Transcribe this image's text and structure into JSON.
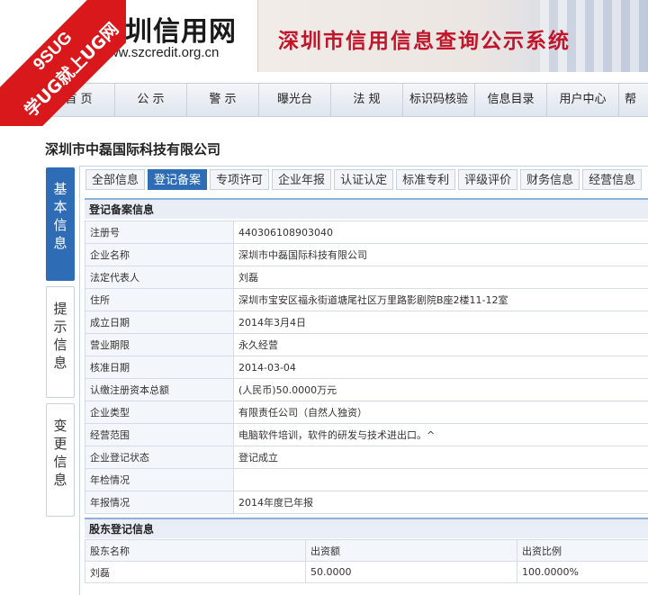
{
  "ribbon": {
    "line1": "9SUG",
    "line2": "学UG就上UG网"
  },
  "header": {
    "logo_text": "深圳信用网",
    "logo_url": "www.szcredit.org.cn",
    "banner_title": "深圳市信用信息查询公示系统"
  },
  "nav": {
    "items": [
      {
        "label": "首  页"
      },
      {
        "label": "公  示"
      },
      {
        "label": "警  示"
      },
      {
        "label": "曝光台"
      },
      {
        "label": "法  规"
      },
      {
        "label": "标识码核验"
      },
      {
        "label": "信息目录"
      },
      {
        "label": "用户中心"
      },
      {
        "label": "帮"
      }
    ]
  },
  "company": {
    "name": "深圳市中磊国际科技有限公司"
  },
  "side_tabs": [
    {
      "c1": "基",
      "c2": "本",
      "c3": "信",
      "c4": "息"
    },
    {
      "c1": "提",
      "c2": "示",
      "c3": "信",
      "c4": "息"
    },
    {
      "c1": "变",
      "c2": "更",
      "c3": "信",
      "c4": "息"
    }
  ],
  "subtabs": [
    {
      "label": "全部信息"
    },
    {
      "label": "登记备案"
    },
    {
      "label": "专项许可"
    },
    {
      "label": "企业年报"
    },
    {
      "label": "认证认定"
    },
    {
      "label": "标准专利"
    },
    {
      "label": "评级评价"
    },
    {
      "label": "财务信息"
    },
    {
      "label": "经营信息"
    }
  ],
  "registration": {
    "section_title": "登记备案信息",
    "rows": [
      {
        "key": "注册号",
        "value": "440306108903040"
      },
      {
        "key": "企业名称",
        "value": "深圳市中磊国际科技有限公司"
      },
      {
        "key": "法定代表人",
        "value": "刘磊"
      },
      {
        "key": "住所",
        "value": "深圳市宝安区福永街道塘尾社区万里路影剧院B座2楼11-12室"
      },
      {
        "key": "成立日期",
        "value": "2014年3月4日"
      },
      {
        "key": "营业期限",
        "value": "永久经营"
      },
      {
        "key": "核准日期",
        "value": "2014-03-04"
      },
      {
        "key": "认缴注册资本总额",
        "value": "(人民币)50.0000万元"
      },
      {
        "key": "企业类型",
        "value": "有限责任公司（自然人独资）"
      },
      {
        "key": "经营范围",
        "value": "电脑软件培训，软件的研发与技术进出口。^"
      },
      {
        "key": "企业登记状态",
        "value": "登记成立"
      },
      {
        "key": "年检情况",
        "value": ""
      },
      {
        "key": "年报情况",
        "value": "2014年度已年报"
      }
    ]
  },
  "shareholders": {
    "section_title": "股东登记信息",
    "headers": [
      "股东名称",
      "出资额",
      "出资比例"
    ],
    "rows": [
      {
        "name": "刘磊",
        "amount": "50.0000",
        "ratio": "100.0000%"
      }
    ]
  }
}
